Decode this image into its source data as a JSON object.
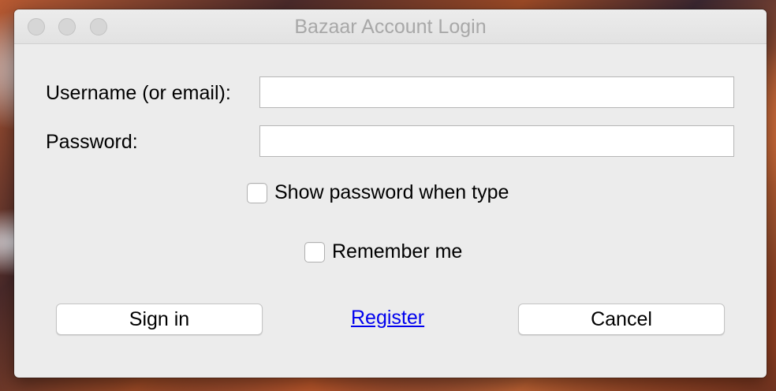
{
  "window": {
    "title": "Bazaar Account Login"
  },
  "form": {
    "username_label": "Username (or email):",
    "username_value": "",
    "password_label": "Password:",
    "password_value": "",
    "show_password_label": "Show password when type",
    "show_password_checked": false,
    "remember_label": "Remember me",
    "remember_checked": false
  },
  "actions": {
    "signin_label": "Sign in",
    "register_label": "Register",
    "cancel_label": "Cancel"
  },
  "colors": {
    "link": "#0000ee",
    "window_background": "#ececec"
  }
}
